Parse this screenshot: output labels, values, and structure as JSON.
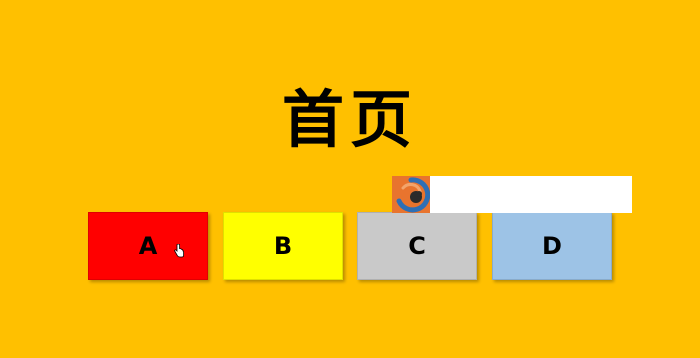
{
  "page": {
    "title": "首页",
    "background_color": "#FFC000"
  },
  "nav_buttons": [
    {
      "label": "A",
      "color": "#FF0000"
    },
    {
      "label": "B",
      "color": "#FFFF00"
    },
    {
      "label": "C",
      "color": "#C9C9C9"
    },
    {
      "label": "D",
      "color": "#9DC3E6"
    }
  ],
  "overlay": {
    "icon": "recorder-app-icon",
    "background_color": "#FFFFFF"
  },
  "cursor": {
    "icon": "hand-pointer-icon"
  }
}
